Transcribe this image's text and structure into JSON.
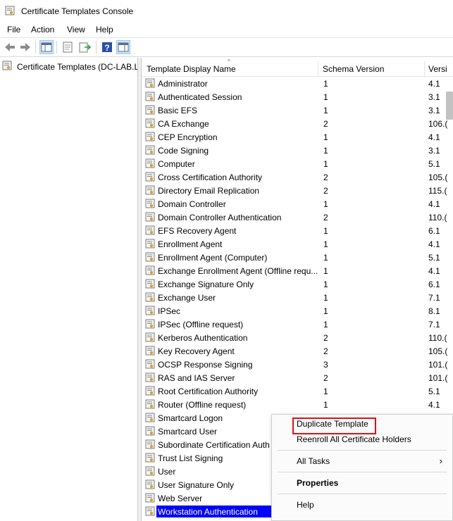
{
  "window": {
    "title": "Certificate Templates Console"
  },
  "menubar": {
    "file": "File",
    "action": "Action",
    "view": "View",
    "help": "Help"
  },
  "toolbar": {
    "buttons": [
      "back-arrow-icon",
      "forward-arrow-icon",
      "show-hide-tree-icon",
      "properties-icon",
      "export-list-icon",
      "help-icon",
      "show-action-pane-icon"
    ]
  },
  "tree": {
    "root_label": "Certificate Templates (DC-LAB.L"
  },
  "list": {
    "columns": [
      "Template Display Name",
      "Schema Version",
      "Versi"
    ],
    "rows": [
      {
        "name": "Administrator",
        "schema": "1",
        "version": "4.1"
      },
      {
        "name": "Authenticated Session",
        "schema": "1",
        "version": "3.1"
      },
      {
        "name": "Basic EFS",
        "schema": "1",
        "version": "3.1"
      },
      {
        "name": "CA Exchange",
        "schema": "2",
        "version": "106.("
      },
      {
        "name": "CEP Encryption",
        "schema": "1",
        "version": "4.1"
      },
      {
        "name": "Code Signing",
        "schema": "1",
        "version": "3.1"
      },
      {
        "name": "Computer",
        "schema": "1",
        "version": "5.1"
      },
      {
        "name": "Cross Certification Authority",
        "schema": "2",
        "version": "105.("
      },
      {
        "name": "Directory Email Replication",
        "schema": "2",
        "version": "115.("
      },
      {
        "name": "Domain Controller",
        "schema": "1",
        "version": "4.1"
      },
      {
        "name": "Domain Controller Authentication",
        "schema": "2",
        "version": "110.("
      },
      {
        "name": "EFS Recovery Agent",
        "schema": "1",
        "version": "6.1"
      },
      {
        "name": "Enrollment Agent",
        "schema": "1",
        "version": "4.1"
      },
      {
        "name": "Enrollment Agent (Computer)",
        "schema": "1",
        "version": "5.1"
      },
      {
        "name": "Exchange Enrollment Agent (Offline requ...",
        "schema": "1",
        "version": "4.1"
      },
      {
        "name": "Exchange Signature Only",
        "schema": "1",
        "version": "6.1"
      },
      {
        "name": "Exchange User",
        "schema": "1",
        "version": "7.1"
      },
      {
        "name": "IPSec",
        "schema": "1",
        "version": "8.1"
      },
      {
        "name": "IPSec (Offline request)",
        "schema": "1",
        "version": "7.1"
      },
      {
        "name": "Kerberos Authentication",
        "schema": "2",
        "version": "110.("
      },
      {
        "name": "Key Recovery Agent",
        "schema": "2",
        "version": "105.("
      },
      {
        "name": "OCSP Response Signing",
        "schema": "3",
        "version": "101.("
      },
      {
        "name": "RAS and IAS Server",
        "schema": "2",
        "version": "101.("
      },
      {
        "name": "Root Certification Authority",
        "schema": "1",
        "version": "5.1"
      },
      {
        "name": "Router (Offline request)",
        "schema": "1",
        "version": "4.1"
      },
      {
        "name": "Smartcard Logon",
        "schema": "",
        "version": ""
      },
      {
        "name": "Smartcard User",
        "schema": "",
        "version": ""
      },
      {
        "name": "Subordinate Certification Auth",
        "schema": "",
        "version": ""
      },
      {
        "name": "Trust List Signing",
        "schema": "",
        "version": ""
      },
      {
        "name": "User",
        "schema": "",
        "version": ""
      },
      {
        "name": "User Signature Only",
        "schema": "",
        "version": ""
      },
      {
        "name": "Web Server",
        "schema": "",
        "version": ""
      },
      {
        "name": "Workstation Authentication",
        "schema": "",
        "version": ""
      }
    ],
    "selected_row": "Workstation Authentication"
  },
  "context_menu": {
    "duplicate": "Duplicate Template",
    "reenroll": "Reenroll All Certificate Holders",
    "all_tasks": "All Tasks",
    "properties": "Properties",
    "help": "Help",
    "highlight_color": "#e01010"
  },
  "colors": {
    "selection": "#0000ff",
    "toolbar_active": "#cce4f7"
  }
}
